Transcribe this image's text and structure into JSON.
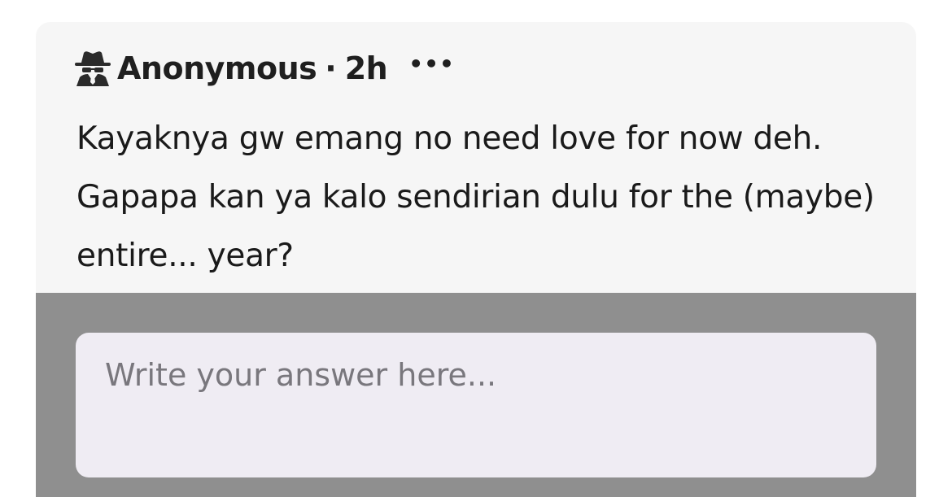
{
  "question": {
    "author": "Anonymous",
    "separator": "·",
    "time": "2h",
    "more_label": "•••",
    "author_icon": "spy-icon",
    "text": "Kayaknya gw emang no need love for now deh. Gapapa kan ya kalo sendirian dulu for the (maybe) entire... year?"
  },
  "answer": {
    "placeholder": "Write your answer here...",
    "value": ""
  },
  "colors": {
    "card_background": "#f6f6f6",
    "answer_area_background": "#8f8f8f",
    "input_background": "#efecf3",
    "placeholder_color": "#79777d"
  }
}
